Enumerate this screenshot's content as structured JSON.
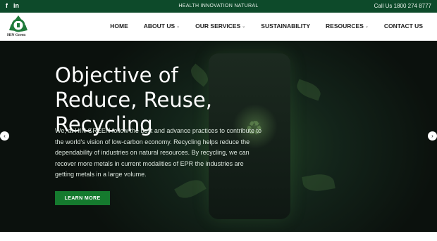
{
  "topbar": {
    "social": [
      "f",
      "in"
    ],
    "tagline": "HEALTH INNOVATION NATURAL",
    "phone": "Call Us 1800 274 8777"
  },
  "brand": {
    "logo_text": "HIN Green",
    "logo_color": "#1f7a3a"
  },
  "nav": {
    "items": [
      {
        "label": "HOME",
        "dropdown": false
      },
      {
        "label": "ABOUT US",
        "dropdown": true
      },
      {
        "label": "OUR SERVICES",
        "dropdown": true
      },
      {
        "label": "SUSTAINABILITY",
        "dropdown": false
      },
      {
        "label": "RESOURCES",
        "dropdown": true
      },
      {
        "label": "CONTACT US",
        "dropdown": false
      }
    ],
    "chevron": "⌄"
  },
  "hero": {
    "title": "Objective of Reduce, Reuse, Recycling",
    "description": "We, at HIN GREEN follow the best and advance practices to contribute to the world's vision of low-carbon economy. Recycling helps reduce the dependability of industries on natural resources. By recycling, we can recover more metals in current modalities of EPR the industries are getting metals in a large volume.",
    "button": "LEARN MORE",
    "prev_arrow": "‹",
    "next_arrow": "›"
  },
  "colors": {
    "topbar": "#0d4a2a",
    "accent": "#157a2e",
    "hero_bg": "#0b110d"
  }
}
